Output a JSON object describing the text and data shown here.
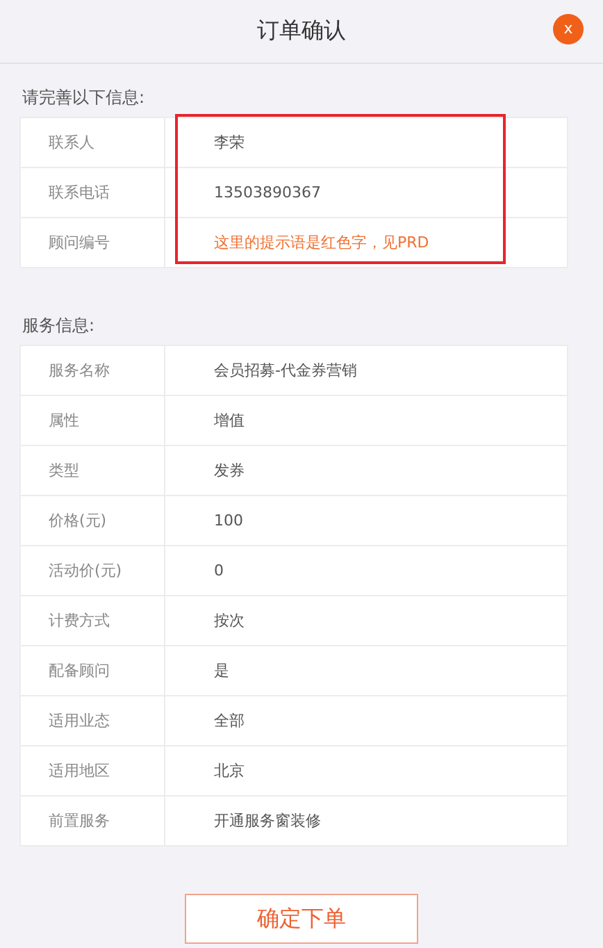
{
  "header": {
    "title": "订单确认",
    "close_label": "x"
  },
  "contact_section": {
    "label": "请完善以下信息:",
    "highlighted": true,
    "rows": [
      {
        "label": "联系人",
        "value": "李荣",
        "kind": "text"
      },
      {
        "label": "联系电话",
        "value": "13503890367",
        "kind": "text"
      },
      {
        "label": "顾问编号",
        "value": "这里的提示语是红色字，见PRD",
        "kind": "hint"
      }
    ]
  },
  "service_section": {
    "label": "服务信息:",
    "rows": [
      {
        "label": "服务名称",
        "value": "会员招募-代金券营销"
      },
      {
        "label": "属性",
        "value": "增值"
      },
      {
        "label": "类型",
        "value": "发券"
      },
      {
        "label": "价格(元)",
        "value": "100"
      },
      {
        "label": "活动价(元)",
        "value": "0"
      },
      {
        "label": "计费方式",
        "value": "按次"
      },
      {
        "label": "配备顾问",
        "value": "是"
      },
      {
        "label": "适用业态",
        "value": "全部"
      },
      {
        "label": "适用地区",
        "value": "北京"
      },
      {
        "label": "前置服务",
        "value": "开通服务窗装修"
      }
    ]
  },
  "submit_button": "确定下单"
}
